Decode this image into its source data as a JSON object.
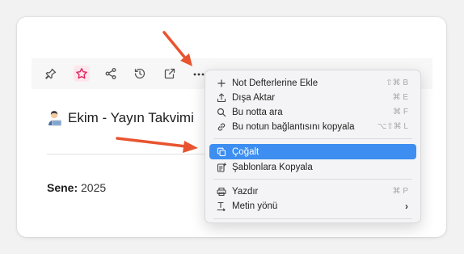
{
  "note": {
    "title": "Ekim - Yayın Takvimi",
    "year_label": "Sene:",
    "year_value": "2025"
  },
  "toolbar": {
    "icons": [
      "pin-icon",
      "star-icon",
      "share-icon",
      "history-icon",
      "open-external-icon",
      "more-icon"
    ],
    "active_color": "#e0245e"
  },
  "menu": {
    "items": [
      {
        "label": "Not Defterlerine Ekle",
        "shortcut": "⇧⌘ B",
        "icon": "plus-icon"
      },
      {
        "label": "Dışa Aktar",
        "shortcut": "⌘ E",
        "icon": "export-icon"
      },
      {
        "label": "Bu notta ara",
        "shortcut": "⌘ F",
        "icon": "search-icon"
      },
      {
        "label": "Bu notun bağlantısını kopyala",
        "shortcut": "⌥⇧⌘ L",
        "icon": "link-icon"
      },
      {
        "label": "Çoğalt",
        "shortcut": "",
        "icon": "duplicate-icon"
      },
      {
        "label": "Şablonlara Kopyala",
        "shortcut": "",
        "icon": "template-icon"
      },
      {
        "label": "Yazdır",
        "shortcut": "⌘ P",
        "icon": "print-icon"
      },
      {
        "label": "Metin yönü",
        "shortcut": "",
        "icon": "text-direction-icon"
      }
    ],
    "highlight_color": "#3d8ef0"
  },
  "annotations": {
    "arrow_color": "#e8542f"
  }
}
